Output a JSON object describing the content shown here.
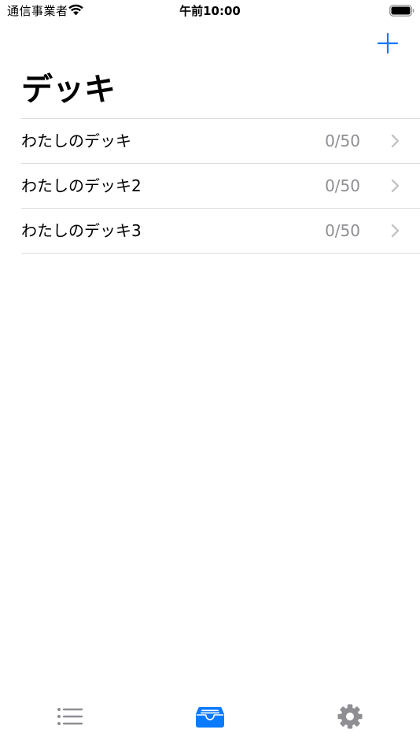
{
  "status_bar": {
    "carrier": "通信事業者",
    "time": "午前10:00"
  },
  "nav": {
    "title": "デッキ",
    "add_icon": "plus-icon"
  },
  "decks": [
    {
      "name": "わたしのデッキ",
      "count": "0/50"
    },
    {
      "name": "わたしのデッキ2",
      "count": "0/50"
    },
    {
      "name": "わたしのデッキ3",
      "count": "0/50"
    }
  ],
  "tab_bar": {
    "tabs": [
      {
        "icon": "list-icon",
        "selected": false
      },
      {
        "icon": "tray-icon",
        "selected": true
      },
      {
        "icon": "gear-icon",
        "selected": false
      }
    ]
  },
  "colors": {
    "accent": "#0a7aff",
    "secondary_text": "#8e8e93",
    "separator": "#dcdcdf",
    "inactive_icon": "#8e8e93"
  }
}
